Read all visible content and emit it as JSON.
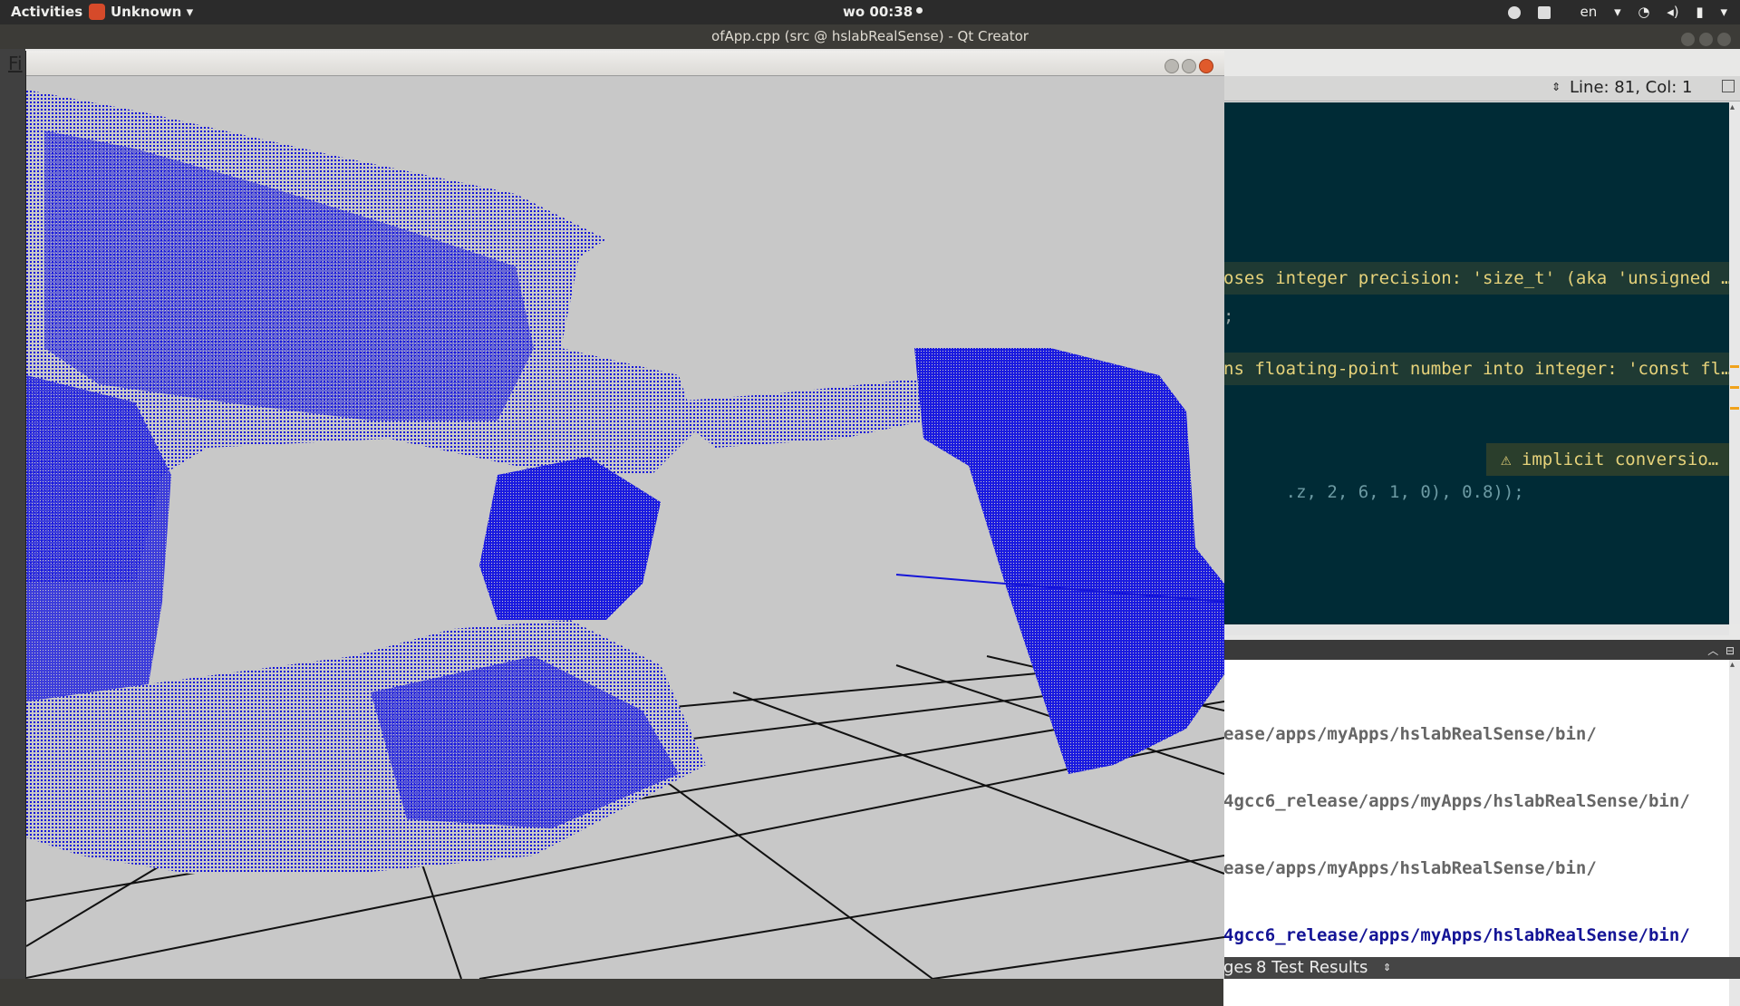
{
  "topbar": {
    "activities": "Activities",
    "app_name": "Unknown",
    "dropdown_arrow": "▾",
    "clock": "wo 00:38",
    "language": "en",
    "tray_icons": [
      "chrome-icon",
      "clipboard-icon",
      "keyboard-icon",
      "wifi-icon",
      "volume-icon",
      "battery-icon",
      "power-menu-icon"
    ]
  },
  "qt_window": {
    "title": "ofApp.cpp (src @ hslabRealSense) - Qt Creator",
    "menu_visible": "Fi"
  },
  "editor": {
    "line_col": "Line: 81, Col: 1",
    "lines": [
      "oses integer precision: 'size_t' (aka 'unsigned …",
      ";",
      "ns floating-point number into integer: 'const fl…",
      ".z, 2, 6, 1, 0), 0.8));"
    ],
    "inline_warning": "⚠ implicit conversio…"
  },
  "output": {
    "lines": [
      "ease/apps/myApps/hslabRealSense/bin/",
      "4gcc6_release/apps/myApps/hslabRealSense/bin/",
      "ease/apps/myApps/hslabRealSense/bin/",
      "4gcc6_release/apps/myApps/hslabRealSense/bin/"
    ]
  },
  "statusbar": {
    "partial_tab": "ges",
    "test_results": "8 Test Results",
    "arrows": "⇕"
  },
  "colors": {
    "point_cloud": "#1010e0",
    "editor_bg": "#002b36",
    "canvas_bg": "#c8c8c8",
    "warning_text": "#e6d27a",
    "output_highlight": "#141496"
  }
}
